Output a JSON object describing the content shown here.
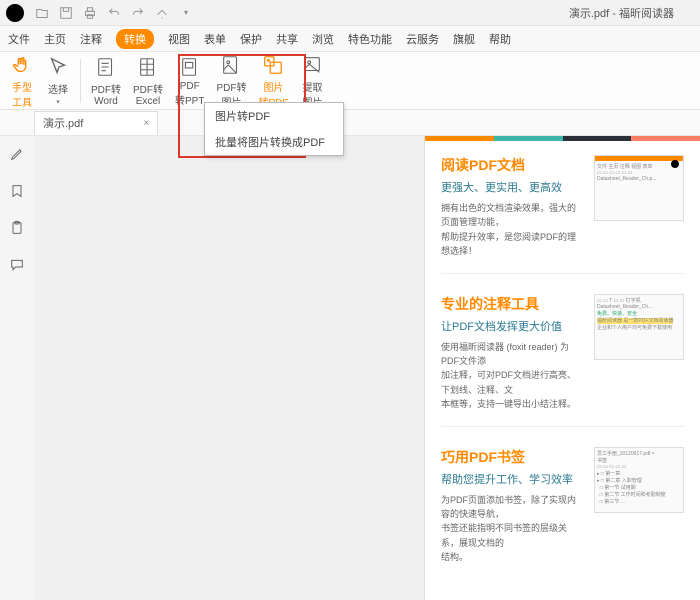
{
  "window": {
    "title": "演示.pdf - 福昕阅读器"
  },
  "menu": [
    "文件",
    "主页",
    "注释",
    "转换",
    "视图",
    "表单",
    "保护",
    "共享",
    "浏览",
    "特色功能",
    "云服务",
    "旗舰",
    "帮助"
  ],
  "menu_active_index": 3,
  "ribbon": {
    "hand": "手型\n工具",
    "select": "选择",
    "pdf_word": "PDF转\nWord",
    "pdf_excel": "PDF转\nExcel",
    "pdf_ppt": "PDF\n转PPT",
    "pdf_img": "PDF转\n图片",
    "img_pdf": "图片\n转PDF",
    "extract_img": "提取\n图片"
  },
  "dropdown": {
    "line1": "图片转PDF",
    "line2": "批量将图片转换成PDF"
  },
  "tab": {
    "name": "演示.pdf",
    "close": "×"
  },
  "doc": {
    "s1": {
      "title": "阅读PDF文档",
      "sub": "更强大、更实用、更高效",
      "p1": "拥有出色的文档渲染效果，强大的页面管理功能，",
      "p2": "帮助提升效率，是您阅读PDF的理想选择！"
    },
    "s2": {
      "title": "专业的注释工具",
      "sub": "让PDF文档发挥更大价值",
      "p1": "使用福昕阅读器 (foxit reader) 为PDF文件添",
      "p2": "加注释，可对PDF文档进行高亮、下划线、注释、文",
      "p3": "本框等，支持一键导出小结注释。",
      "t_green": "免费、快速、安全"
    },
    "s3": {
      "title": "巧用PDF书签",
      "sub": "帮助您提升工作、学习效率",
      "p1": "为PDF页面添加书签，除了实现内容的快速导航，",
      "p2": "书签还能指明不同书签的层级关系，展现文档的",
      "p3": "结构。"
    }
  }
}
